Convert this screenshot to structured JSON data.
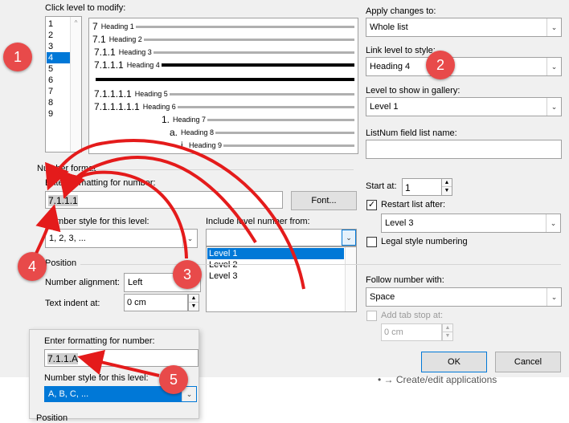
{
  "level_section": {
    "label": "Click level to modify:",
    "levels": [
      "1",
      "2",
      "3",
      "4",
      "5",
      "6",
      "7",
      "8",
      "9"
    ],
    "selected_level": "4"
  },
  "preview": {
    "rows": [
      {
        "num": "7",
        "heading": "Heading 1"
      },
      {
        "num": "7.1",
        "heading": "Heading 2"
      },
      {
        "num": "7.1.1",
        "heading": "Heading 3"
      },
      {
        "num": "7.1.1.1",
        "heading": "Heading 4"
      },
      {
        "num": "7.1.1.1.1",
        "heading": "Heading 5"
      },
      {
        "num": "7.1.1.1.1.1",
        "heading": "Heading 6"
      },
      {
        "num": "1.",
        "heading": "Heading 7"
      },
      {
        "num": "a.",
        "heading": "Heading 8"
      },
      {
        "num": "i.",
        "heading": "Heading 9"
      }
    ]
  },
  "right_panel": {
    "apply_label": "Apply changes to:",
    "apply_value": "Whole list",
    "link_label": "Link level to style:",
    "link_value": "Heading 4",
    "gallery_label": "Level to show in gallery:",
    "gallery_value": "Level 1",
    "listnum_label": "ListNum field list name:",
    "listnum_value": ""
  },
  "number_format": {
    "group_label": "Number format",
    "enter_label": "Enter formatting for number:",
    "enter_value": "7.1.1.1",
    "font_button": "Font...",
    "style_label": "Number style for this level:",
    "style_value": "1, 2, 3, ...",
    "include_label": "Include level number from:",
    "include_value": "",
    "include_options": [
      "Level 1",
      "Level 2",
      "Level 3"
    ],
    "include_selected": "Level 1",
    "start_label": "Start at:",
    "start_value": "1",
    "restart_label": "Restart list after:",
    "restart_checked": true,
    "restart_value": "Level 3",
    "legal_label": "Legal style numbering",
    "legal_checked": false
  },
  "position": {
    "group_label": "Position",
    "alignment_label": "Number alignment:",
    "alignment_value": "Left",
    "indent_label": "Text indent at:",
    "indent_value": "0 cm",
    "follow_label": "Follow number with:",
    "follow_value": "Space",
    "tabstop_label": "Add tab stop at:",
    "tabstop_value": "0 cm"
  },
  "buttons": {
    "ok": "OK",
    "cancel": "Cancel"
  },
  "popup": {
    "enter_label": "Enter formatting for number:",
    "enter_value": "7.1.1.A",
    "style_label": "Number style for this level:",
    "style_value": "A, B, C, ...",
    "position_label": "Position"
  },
  "background_text": "Create/edit applications",
  "badges": [
    "1",
    "2",
    "3",
    "4",
    "5"
  ],
  "colors": {
    "accent": "#0078d7",
    "badge": "#e84a4a",
    "arrow": "#e41b1b"
  }
}
